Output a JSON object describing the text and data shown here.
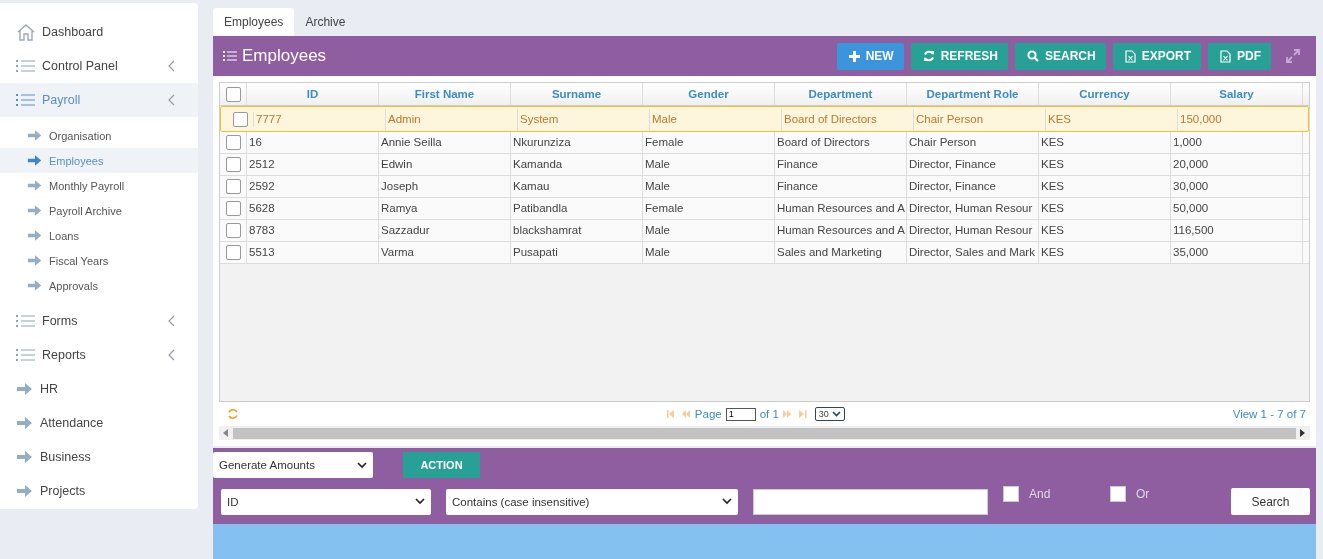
{
  "sidebar": {
    "items": [
      {
        "label": "Dashboard",
        "kind": "home",
        "selected": false
      },
      {
        "label": "Control Panel",
        "kind": "menu",
        "selected": false
      },
      {
        "label": "Payroll",
        "kind": "menu",
        "selected": true,
        "children": [
          {
            "label": "Organisation",
            "selected": false
          },
          {
            "label": "Employees",
            "selected": true
          },
          {
            "label": "Monthly Payroll",
            "selected": false
          },
          {
            "label": "Payroll Archive",
            "selected": false
          },
          {
            "label": "Loans",
            "selected": false
          },
          {
            "label": "Fiscal Years",
            "selected": false
          },
          {
            "label": "Approvals",
            "selected": false
          }
        ]
      },
      {
        "label": "Forms",
        "kind": "menu",
        "selected": false
      },
      {
        "label": "Reports",
        "kind": "menu",
        "selected": false
      },
      {
        "label": "HR",
        "kind": "link",
        "selected": false
      },
      {
        "label": "Attendance",
        "kind": "link",
        "selected": false
      },
      {
        "label": "Business",
        "kind": "link",
        "selected": false
      },
      {
        "label": "Projects",
        "kind": "link",
        "selected": false
      }
    ]
  },
  "tabs": [
    {
      "label": "Employees",
      "selected": true
    },
    {
      "label": "Archive",
      "selected": false
    }
  ],
  "panel": {
    "title": "Employees",
    "toolbar": [
      {
        "label": "NEW",
        "kind": "new"
      },
      {
        "label": "REFRESH",
        "kind": "refresh"
      },
      {
        "label": "SEARCH",
        "kind": "search"
      },
      {
        "label": "EXPORT",
        "kind": "export"
      },
      {
        "label": "PDF",
        "kind": "pdf"
      }
    ]
  },
  "table": {
    "all_checked": false,
    "columns": [
      "ID",
      "First Name",
      "Surname",
      "Gender",
      "Department",
      "Department Role",
      "Currency",
      "Salary"
    ],
    "rows": [
      {
        "selected": true,
        "checked": false,
        "cells": [
          "7777",
          "Admin",
          "System",
          "Male",
          "Board of Directors",
          "Chair Person",
          "KES",
          "150,000"
        ]
      },
      {
        "selected": false,
        "checked": false,
        "cells": [
          "16",
          "Annie Seilla",
          "Nkurunziza",
          "Female",
          "Board of Directors",
          "Chair Person",
          "KES",
          "1,000"
        ]
      },
      {
        "selected": false,
        "checked": false,
        "cells": [
          "2512",
          "Edwin",
          "Kamanda",
          "Male",
          "Finance",
          "Director, Finance",
          "KES",
          "20,000"
        ]
      },
      {
        "selected": false,
        "checked": false,
        "cells": [
          "2592",
          "Joseph",
          "Kamau",
          "Male",
          "Finance",
          "Director, Finance",
          "KES",
          "30,000"
        ]
      },
      {
        "selected": false,
        "checked": false,
        "cells": [
          "5628",
          "Ramya",
          "Patibandla",
          "Female",
          "Human Resources and A",
          "Director, Human Resour",
          "KES",
          "50,000"
        ]
      },
      {
        "selected": false,
        "checked": false,
        "cells": [
          "8783",
          "Sazzadur",
          "blackshamrat",
          "Male",
          "Human Resources and A",
          "Director, Human Resour",
          "KES",
          "116,500"
        ]
      },
      {
        "selected": false,
        "checked": false,
        "cells": [
          "5513",
          "Varma",
          "Pusapati",
          "Male",
          "Sales and Marketing",
          "Director, Sales and Mark",
          "KES",
          "35,000"
        ]
      }
    ]
  },
  "pager": {
    "page_label": "Page",
    "page": "1",
    "of": "of 1",
    "page_size": "30",
    "view": "View 1 - 7 of 7"
  },
  "actions": {
    "select": "Generate Amounts",
    "button": "ACTION"
  },
  "filter": {
    "field": "ID",
    "operator": "Contains (case insensitive)",
    "and": {
      "label": "And",
      "checked": false
    },
    "or": {
      "label": "Or",
      "checked": false
    },
    "button": "Search"
  }
}
